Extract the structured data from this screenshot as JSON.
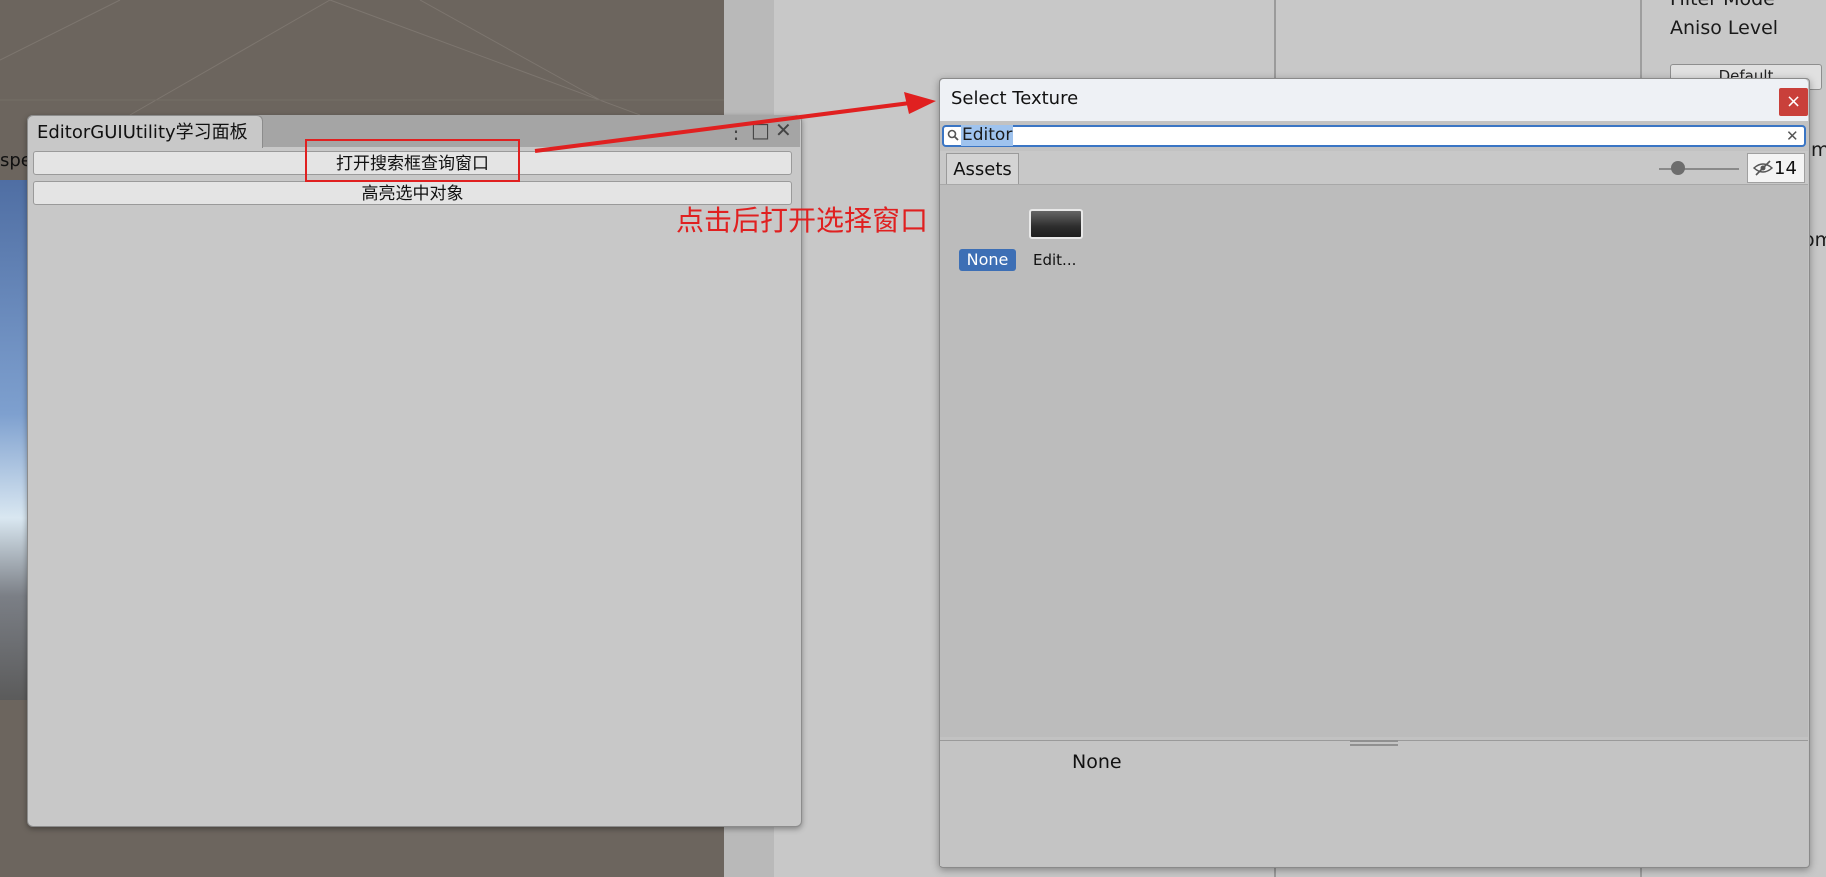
{
  "colors": {
    "annotation_red": "#e02020",
    "selection_blue": "#3d6fb5",
    "close_button_red": "#c9403a"
  },
  "left_edge_label": "spe",
  "inspector": {
    "items": [
      "Filter Mode",
      "Aniso Level"
    ],
    "default_button": "Default",
    "partial_labels": [
      "m",
      "om"
    ]
  },
  "panel": {
    "tab_title": "EditorGUIUtility学习面板",
    "window_controls": {
      "menu": "⋮",
      "maximize": "□",
      "close": "✕"
    },
    "buttons": [
      "打开搜索框查询窗口",
      "高亮选中对象"
    ]
  },
  "annotation": {
    "text": "点击后打开选择窗口"
  },
  "select_window": {
    "title": "Select Texture",
    "close_symbol": "×",
    "search": {
      "value": "Editor",
      "clear_symbol": "✕"
    },
    "tabs": [
      "Assets"
    ],
    "visibility_count": "14",
    "items": [
      {
        "label": "None",
        "selected": true
      },
      {
        "label": "Edit...",
        "selected": false,
        "icon": "texture-thumbnail"
      }
    ],
    "preview_label": "None"
  }
}
